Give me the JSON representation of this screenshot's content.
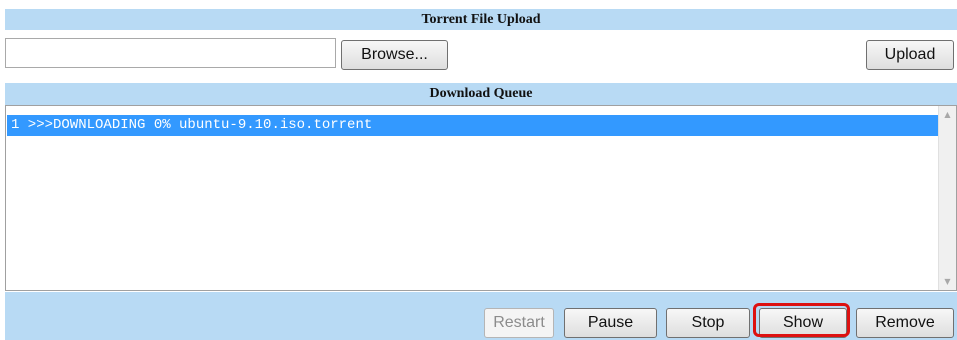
{
  "upload_section": {
    "title": "Torrent File Upload",
    "file_value": "",
    "browse_label": "Browse...",
    "upload_label": "Upload"
  },
  "queue_section": {
    "title": "Download Queue",
    "items": [
      {
        "text": "1 >>>DOWNLOADING 0% ubuntu-9.10.iso.torrent",
        "selected": true
      }
    ]
  },
  "actions": {
    "restart_label": "Restart",
    "restart_enabled": false,
    "pause_label": "Pause",
    "stop_label": "Stop",
    "show_label": "Show",
    "remove_label": "Remove"
  },
  "icons": {
    "scroll_up": "scroll-up-icon",
    "scroll_down": "scroll-down-icon"
  },
  "colors": {
    "header_bg": "#b8daf4",
    "selection_bg": "#3399ff",
    "highlight": "#dd1111"
  }
}
